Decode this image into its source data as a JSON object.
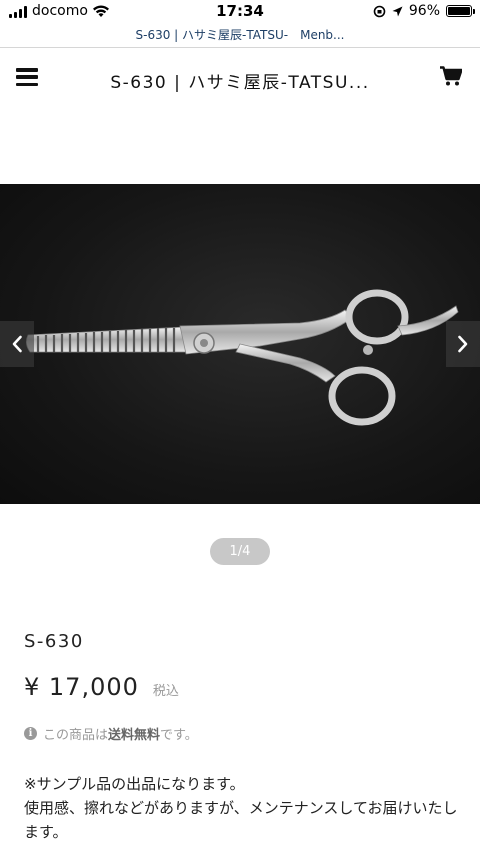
{
  "status_bar": {
    "carrier": "docomo",
    "time": "17:34",
    "battery": "96%"
  },
  "url_bar": {
    "title": "S-630 | ハサミ屋辰-TATSU-　Menb..."
  },
  "header": {
    "site_title": "S-630 | ハサミ屋辰-TATSU..."
  },
  "carousel": {
    "pager": "1/4"
  },
  "product": {
    "name": "S-630",
    "price": "¥ 17,000",
    "tax_label": "税込",
    "shipping_prefix": "この商品は",
    "shipping_bold": "送料無料",
    "shipping_suffix": "です。",
    "description_line1": "※サンプル品の出品になります。",
    "description_line2": "使用感、擦れなどがありますが、メンテナンスしてお届けいたします。"
  }
}
